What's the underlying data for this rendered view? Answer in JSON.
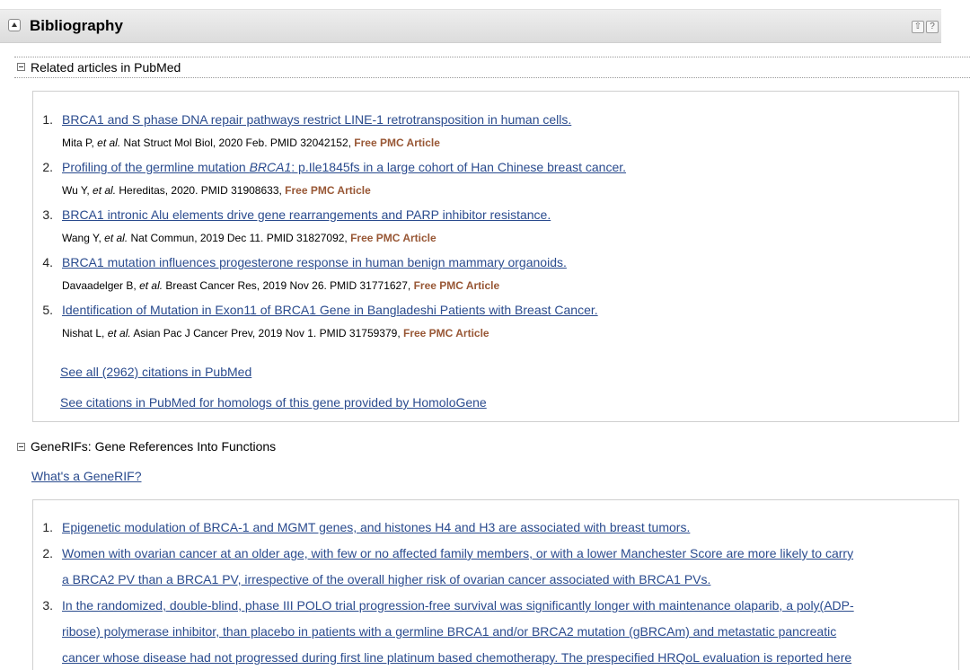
{
  "section": {
    "title": "Bibliography",
    "up_glyph": "⇧",
    "help_glyph": "?"
  },
  "related": {
    "label": "Related articles in PubMed",
    "items": [
      {
        "num": "1.",
        "title": "BRCA1 and S phase DNA repair pathways restrict LINE-1 retrotransposition in human cells.",
        "author": "Mita P, ",
        "etal": "et al.",
        "meta": " Nat Struct Mol Biol, 2020 Feb. PMID 32042152, ",
        "free": "Free PMC Article"
      },
      {
        "num": "2.",
        "title_pre": "Profiling of the germline mutation ",
        "title_em": "BRCA1",
        "title_post": ": p.Ile1845fs in a large cohort of Han Chinese breast cancer.",
        "author": "Wu Y, ",
        "etal": "et al.",
        "meta": " Hereditas, 2020. PMID 31908633, ",
        "free": "Free PMC Article"
      },
      {
        "num": "3.",
        "title": "BRCA1 intronic Alu elements drive gene rearrangements and PARP inhibitor resistance.",
        "author": "Wang Y, ",
        "etal": "et al.",
        "meta": " Nat Commun, 2019 Dec 11. PMID 31827092, ",
        "free": "Free PMC Article"
      },
      {
        "num": "4.",
        "title": "BRCA1 mutation influences progesterone response in human benign mammary organoids.",
        "author": "Davaadelger B, ",
        "etal": "et al.",
        "meta": " Breast Cancer Res, 2019 Nov 26. PMID 31771627, ",
        "free": "Free PMC Article"
      },
      {
        "num": "5.",
        "title": "Identification of Mutation in Exon11 of BRCA1 Gene in Bangladeshi Patients with Breast Cancer.",
        "author": "Nishat L, ",
        "etal": "et al.",
        "meta": " Asian Pac J Cancer Prev, 2019 Nov 1. PMID 31759379, ",
        "free": "Free PMC Article"
      }
    ],
    "see_all": "See all (2962) citations in PubMed",
    "see_homologs": "See citations in PubMed for homologs of this gene provided by HomoloGene"
  },
  "generifs": {
    "label": "GeneRIFs: Gene References Into Functions",
    "whats_link": "What's a GeneRIF?",
    "items": [
      {
        "num": "1.",
        "lines": [
          "Epigenetic modulation of BRCA-1 and MGMT genes, and histones H4 and H3 are associated with breast tumors."
        ]
      },
      {
        "num": "2.",
        "lines": [
          "Women with ovarian cancer at an older age, with few or no affected family members, or with a lower Manchester Score are more likely to carry",
          "a BRCA2 PV than a BRCA1 PV, irrespective of the overall higher risk of ovarian cancer associated with BRCA1 PVs."
        ]
      },
      {
        "num": "3.",
        "lines": [
          "In the randomized, double-blind, phase III POLO trial progression-free survival was significantly longer with maintenance olaparib, a poly(ADP-",
          "ribose) polymerase inhibitor, than placebo in patients with a germline BRCA1 and/or BRCA2 mutation (gBRCAm) and metastatic pancreatic",
          "cancer whose disease had not progressed during first line platinum based chemotherapy. The prespecified HRQoL evaluation is reported here"
        ]
      }
    ]
  }
}
